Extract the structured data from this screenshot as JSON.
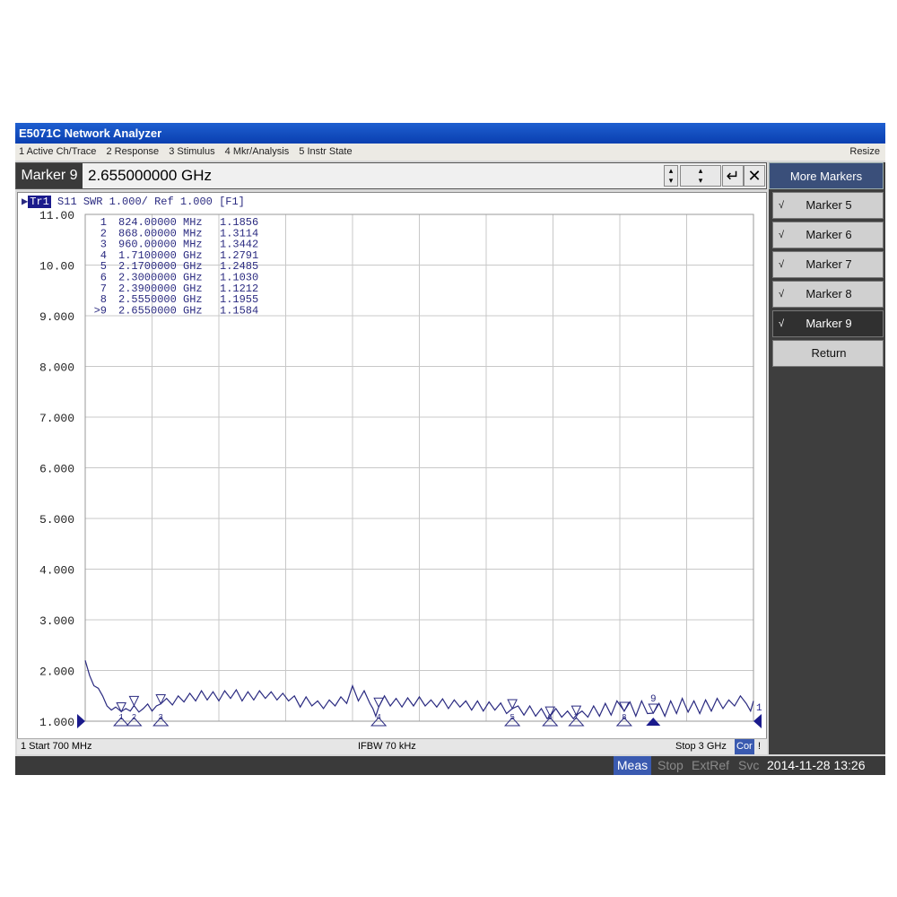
{
  "window": {
    "title": "E5071C Network Analyzer",
    "resize_label": "Resize"
  },
  "menu": [
    "1 Active Ch/Trace",
    "2 Response",
    "3 Stimulus",
    "4 Mkr/Analysis",
    "5 Instr State"
  ],
  "entry": {
    "label": "Marker 9",
    "value": "2.655000000 GHz",
    "enter_icon": "enter-arrow-icon",
    "close_icon": "close-icon"
  },
  "softkeys": {
    "title": "More Markers",
    "items": [
      {
        "label": "Marker 5",
        "checked": true,
        "active": false
      },
      {
        "label": "Marker 6",
        "checked": true,
        "active": false
      },
      {
        "label": "Marker 7",
        "checked": true,
        "active": false
      },
      {
        "label": "Marker 8",
        "checked": true,
        "active": false
      },
      {
        "label": "Marker 9",
        "checked": true,
        "active": true
      },
      {
        "label": "Return",
        "checked": false,
        "active": false
      }
    ],
    "check_glyph": "√"
  },
  "trace": {
    "badge": "Tr1",
    "text": "S11  SWR 1.000/ Ref 1.000 [F1]"
  },
  "markers_table": [
    {
      "id": "1",
      "freq": "824.00000 MHz",
      "value": "1.1856"
    },
    {
      "id": "2",
      "freq": "868.00000 MHz",
      "value": "1.3114"
    },
    {
      "id": "3",
      "freq": "960.00000 MHz",
      "value": "1.3442"
    },
    {
      "id": "4",
      "freq": "1.7100000 GHz",
      "value": "1.2791"
    },
    {
      "id": "5",
      "freq": "2.1700000 GHz",
      "value": "1.2485"
    },
    {
      "id": "6",
      "freq": "2.3000000 GHz",
      "value": "1.1030"
    },
    {
      "id": "7",
      "freq": "2.3900000 GHz",
      "value": "1.1212"
    },
    {
      "id": "8",
      "freq": "2.5550000 GHz",
      "value": "1.1955"
    },
    {
      "id": ">9",
      "freq": "2.6550000 GHz",
      "value": "1.1584"
    }
  ],
  "status_row": {
    "start": "1  Start 700 MHz",
    "ifbw": "IFBW 70 kHz",
    "stop": "Stop 3 GHz",
    "cor": "Cor",
    "bang": "!"
  },
  "bottom_bar": {
    "meas": "Meas",
    "stop": "Stop",
    "extref": "ExtRef",
    "svc": "Svc",
    "datetime": "2014-11-28 13:26"
  },
  "chart_data": {
    "type": "line",
    "x_range": [
      0.7,
      3.0
    ],
    "ylim": [
      1.0,
      11.0
    ],
    "y_ticks": [
      "11.00",
      "10.00",
      "9.000",
      "8.000",
      "7.000",
      "6.000",
      "5.000",
      "4.000",
      "3.000",
      "2.000",
      "1.000"
    ],
    "grid": true,
    "series": [
      {
        "x": [
          0.7,
          0.715,
          0.73,
          0.745,
          0.76,
          0.775,
          0.79,
          0.805,
          0.824,
          0.84,
          0.855,
          0.868,
          0.885,
          0.9,
          0.915,
          0.93,
          0.945,
          0.96,
          0.98,
          1.0,
          1.02,
          1.04,
          1.06,
          1.08,
          1.1,
          1.12,
          1.14,
          1.16,
          1.18,
          1.2,
          1.22,
          1.24,
          1.26,
          1.28,
          1.3,
          1.32,
          1.34,
          1.36,
          1.38,
          1.4,
          1.42,
          1.44,
          1.46,
          1.48,
          1.5,
          1.52,
          1.54,
          1.56,
          1.58,
          1.6,
          1.62,
          1.64,
          1.66,
          1.68,
          1.69,
          1.7,
          1.71,
          1.73,
          1.75,
          1.77,
          1.79,
          1.81,
          1.83,
          1.85,
          1.87,
          1.89,
          1.91,
          1.93,
          1.95,
          1.97,
          1.99,
          2.01,
          2.03,
          2.05,
          2.07,
          2.09,
          2.11,
          2.13,
          2.15,
          2.17,
          2.19,
          2.21,
          2.23,
          2.25,
          2.27,
          2.29,
          2.3,
          2.32,
          2.34,
          2.36,
          2.38,
          2.39,
          2.41,
          2.43,
          2.45,
          2.47,
          2.49,
          2.51,
          2.53,
          2.555,
          2.575,
          2.595,
          2.615,
          2.635,
          2.655,
          2.675,
          2.695,
          2.715,
          2.735,
          2.755,
          2.775,
          2.795,
          2.815,
          2.835,
          2.855,
          2.875,
          2.895,
          2.915,
          2.935,
          2.955,
          2.975,
          2.99,
          3.0
        ],
        "y": [
          2.2,
          1.9,
          1.7,
          1.65,
          1.5,
          1.3,
          1.22,
          1.28,
          1.19,
          1.25,
          1.2,
          1.31,
          1.18,
          1.25,
          1.34,
          1.2,
          1.3,
          1.34,
          1.45,
          1.32,
          1.5,
          1.38,
          1.55,
          1.4,
          1.6,
          1.42,
          1.58,
          1.4,
          1.6,
          1.45,
          1.62,
          1.4,
          1.58,
          1.42,
          1.6,
          1.45,
          1.58,
          1.42,
          1.55,
          1.4,
          1.5,
          1.28,
          1.48,
          1.3,
          1.4,
          1.25,
          1.42,
          1.3,
          1.48,
          1.35,
          1.7,
          1.4,
          1.6,
          1.35,
          1.25,
          1.1,
          1.28,
          1.5,
          1.3,
          1.45,
          1.28,
          1.46,
          1.3,
          1.48,
          1.3,
          1.42,
          1.28,
          1.44,
          1.25,
          1.42,
          1.28,
          1.4,
          1.22,
          1.4,
          1.2,
          1.38,
          1.22,
          1.36,
          1.15,
          1.25,
          1.3,
          1.12,
          1.3,
          1.1,
          1.25,
          1.05,
          1.1,
          1.25,
          1.08,
          1.2,
          1.05,
          1.12,
          1.2,
          1.08,
          1.3,
          1.1,
          1.35,
          1.12,
          1.4,
          1.2,
          1.38,
          1.1,
          1.4,
          1.15,
          1.16,
          1.35,
          1.1,
          1.4,
          1.15,
          1.45,
          1.18,
          1.4,
          1.15,
          1.42,
          1.2,
          1.45,
          1.25,
          1.42,
          1.3,
          1.5,
          1.35,
          1.2,
          1.4
        ]
      }
    ],
    "markers": [
      {
        "id": "1",
        "x": 0.824,
        "y": 1.1856
      },
      {
        "id": "2",
        "x": 0.868,
        "y": 1.3114
      },
      {
        "id": "3",
        "x": 0.96,
        "y": 1.3442
      },
      {
        "id": "4",
        "x": 1.71,
        "y": 1.2791
      },
      {
        "id": "5",
        "x": 2.17,
        "y": 1.2485
      },
      {
        "id": "6",
        "x": 2.3,
        "y": 1.103
      },
      {
        "id": "7",
        "x": 2.39,
        "y": 1.1212
      },
      {
        "id": "8",
        "x": 2.555,
        "y": 1.1955
      },
      {
        "id": "9",
        "x": 2.655,
        "y": 1.1584,
        "active": true
      }
    ],
    "trace_color": "#2a2a80",
    "grid_color": "#c8c8c8"
  }
}
